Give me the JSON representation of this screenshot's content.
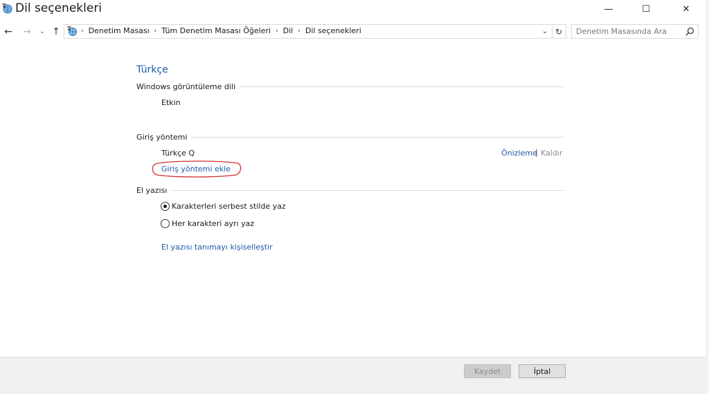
{
  "window": {
    "title": "Dil seçenekleri",
    "minimize_symbol": "—",
    "maximize_symbol": "☐",
    "close_symbol": "✕"
  },
  "nav": {
    "back_symbol": "←",
    "forward_symbol": "→",
    "recent_symbol": "⌄",
    "up_symbol": "↑",
    "breadcrumbs": [
      "Denetim Masası",
      "Tüm Denetim Masası Öğeleri",
      "Dil",
      "Dil seçenekleri"
    ],
    "separator": "›",
    "dropdown_symbol": "⌄",
    "refresh_symbol": "↻"
  },
  "search": {
    "placeholder": "Denetim Masasında Ara"
  },
  "content": {
    "language_title": "Türkçe",
    "display_language": {
      "heading": "Windows görüntüleme dili",
      "status": "Etkin"
    },
    "input_method": {
      "heading": "Giriş yöntemi",
      "method_name": "Türkçe Q",
      "preview_link": "Önizleme",
      "separator": "|",
      "remove_link": "Kaldır",
      "add_link": "Giriş yöntemi ekle"
    },
    "handwriting": {
      "heading": "El yazısı",
      "options": [
        {
          "label": "Karakterleri serbest stilde yaz",
          "checked": true
        },
        {
          "label": "Her karakteri ayrı yaz",
          "checked": false
        }
      ],
      "personalize_link": "El yazısı tanımayı kişiselleştir"
    }
  },
  "footer": {
    "save_label": "Kaydet",
    "cancel_label": "İptal"
  },
  "colors": {
    "link": "#1e5aa8",
    "annotation": "#d32f2f"
  }
}
